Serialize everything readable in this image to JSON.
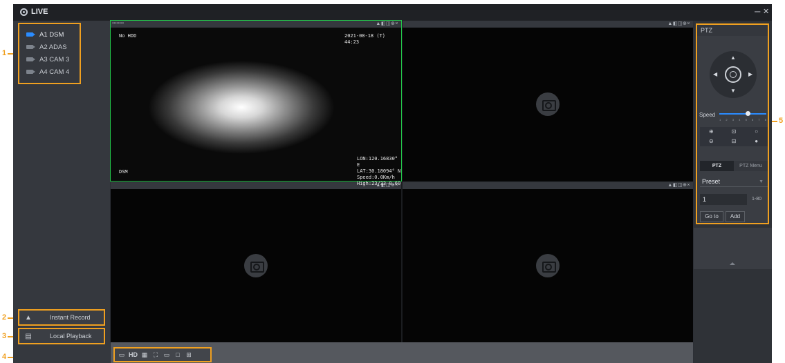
{
  "window": {
    "title": "LIVE",
    "minimize": "–",
    "close": "✕"
  },
  "callouts": [
    "1",
    "2",
    "3",
    "4",
    "5"
  ],
  "sidebar": {
    "channels": [
      {
        "label": "A1 DSM",
        "active": true,
        "icon": "camera-icon"
      },
      {
        "label": "A2 ADAS",
        "active": false,
        "icon": "camera-icon"
      },
      {
        "label": "A3 CAM 3",
        "active": false,
        "icon": "camera-icon"
      },
      {
        "label": "A4 CAM 4",
        "active": false,
        "icon": "camera-icon"
      }
    ],
    "instant_record": {
      "label": "Instant Record",
      "icon": "warning-icon"
    },
    "local_playback": {
      "label": "Local Playback",
      "icon": "film-icon"
    }
  },
  "video": {
    "tiles": [
      {
        "tool_icons": "▲◧◫⊕×",
        "status_left": "No HDD",
        "datetime": "2021-08-18 (T) 44:23",
        "channel_name": "DSM",
        "gps": [
          "LON:120.16830° E",
          "LAT:30.18094° N",
          "Speed:0.0Km/h",
          "High:23/33 0.60"
        ]
      },
      {
        "tool_icons": "▲◧◫⊕×"
      },
      {
        "tool_icons": "▲◧◫⊕×"
      },
      {
        "tool_icons": "▲◧◫⊕×"
      }
    ]
  },
  "toolbar": {
    "items": [
      "▭",
      "HD",
      "▦",
      "⛶",
      "▭",
      "□",
      "⊞"
    ],
    "hd_label": "HD"
  },
  "ptz": {
    "header": "PTZ",
    "speed_label": "Speed",
    "speed_value": 0.6,
    "speed_ticks": [
      "1",
      "2",
      "3",
      "4",
      "5",
      "6",
      "7",
      "8"
    ],
    "tabs": [
      "PTZ",
      "PTZ Menu"
    ],
    "preset_label": "Preset",
    "preset_value": "1",
    "preset_range": "1-80",
    "go_to": "Go to",
    "add": "Add"
  }
}
